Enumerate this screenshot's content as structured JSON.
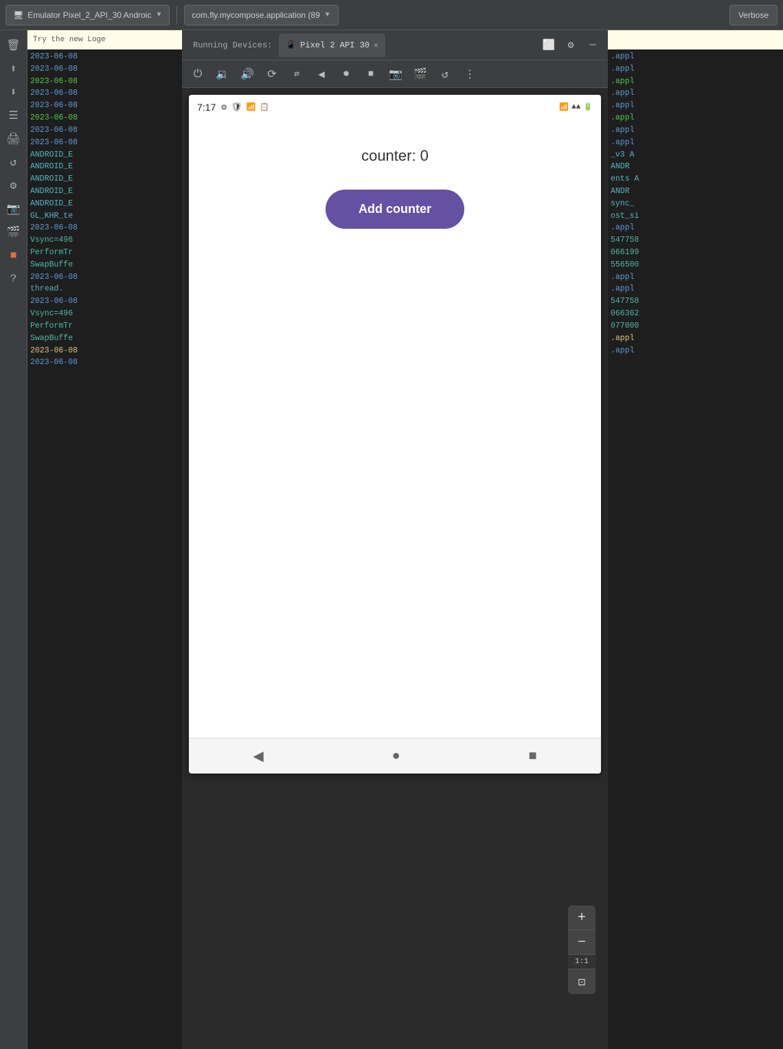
{
  "topbar": {
    "emulator_label": "Emulator Pixel_2_API_30 Androic",
    "app_id": "com.fly.mycompose.application (89",
    "verbose": "Verbose"
  },
  "running_devices": {
    "label": "Running Devices:",
    "tab_name": "Pixel 2 API 30"
  },
  "phone": {
    "time": "7:17",
    "counter_text": "counter: 0",
    "add_button_label": "Add counter"
  },
  "left_log": {
    "try_bar": "Try the new Loge",
    "lines": [
      {
        "text": "2023-06-08",
        "color": "blue"
      },
      {
        "text": "2023-06-08",
        "color": "blue"
      },
      {
        "text": "2023-06-08",
        "color": "green"
      },
      {
        "text": "2023-06-08",
        "color": "blue"
      },
      {
        "text": "2023-06-08",
        "color": "blue"
      },
      {
        "text": "2023-06-08",
        "color": "green"
      },
      {
        "text": "2023-06-08",
        "color": "blue"
      },
      {
        "text": "2023-06-08",
        "color": "blue"
      },
      {
        "text": "ANDROID_E",
        "color": "cyan"
      },
      {
        "text": "ANDROID_E",
        "color": "cyan"
      },
      {
        "text": "ANDROID_E",
        "color": "cyan"
      },
      {
        "text": "ANDROID_E",
        "color": "cyan"
      },
      {
        "text": "ANDROID_E",
        "color": "cyan"
      },
      {
        "text": "GL_KHR_te",
        "color": "cyan"
      },
      {
        "text": "2023-06-08",
        "color": "blue"
      },
      {
        "text": "Vsync=496",
        "color": "teal"
      },
      {
        "text": "PerformTr",
        "color": "teal"
      },
      {
        "text": "SwapBuffe",
        "color": "teal"
      },
      {
        "text": "2023-06-08",
        "color": "blue"
      },
      {
        "text": "thread.",
        "color": "teal"
      },
      {
        "text": "2023-06-08",
        "color": "blue"
      },
      {
        "text": "Vsync=496",
        "color": "teal"
      },
      {
        "text": "PerformTr",
        "color": "teal"
      },
      {
        "text": "SwapBuffe",
        "color": "teal"
      },
      {
        "text": "2023-06-08",
        "color": "yellow"
      },
      {
        "text": "2023-06-08",
        "color": "blue"
      }
    ]
  },
  "right_log": {
    "try_bar": "",
    "lines": [
      {
        "text": ".appl",
        "color": "blue"
      },
      {
        "text": ".appl",
        "color": "blue"
      },
      {
        "text": ".appl",
        "color": "green"
      },
      {
        "text": ".appl",
        "color": "blue"
      },
      {
        "text": ".appl",
        "color": "blue"
      },
      {
        "text": ".appl",
        "color": "green"
      },
      {
        "text": ".appl",
        "color": "blue"
      },
      {
        "text": ".appl",
        "color": "blue"
      },
      {
        "text": "_v3 A",
        "color": "cyan"
      },
      {
        "text": "ANDR",
        "color": "cyan"
      },
      {
        "text": "ents A",
        "color": "cyan"
      },
      {
        "text": "ANDR",
        "color": "cyan"
      },
      {
        "text": "sync_",
        "color": "cyan"
      },
      {
        "text": "ost_si",
        "color": "cyan"
      },
      {
        "text": ".appl",
        "color": "blue"
      },
      {
        "text": "547758",
        "color": "teal"
      },
      {
        "text": "066199",
        "color": "teal"
      },
      {
        "text": "556500",
        "color": "teal"
      },
      {
        "text": ".appl",
        "color": "blue"
      },
      {
        "text": "",
        "color": "white"
      },
      {
        "text": ".appl",
        "color": "blue"
      },
      {
        "text": "547758",
        "color": "teal"
      },
      {
        "text": "066362",
        "color": "teal"
      },
      {
        "text": "077000",
        "color": "teal"
      },
      {
        "text": ".appl",
        "color": "yellow"
      },
      {
        "text": ".appl",
        "color": "blue"
      }
    ]
  },
  "icons": {
    "trash": "🗑",
    "push": "⬆",
    "pull": "⬇",
    "list": "☰",
    "print": "🖨",
    "refresh": "↺",
    "settings": "⚙",
    "camera": "📷",
    "video": "🎬",
    "question": "?",
    "power": "⏻",
    "volume_down": "🔉",
    "volume_up": "🔊",
    "rotate": "⟳",
    "back_btn": "⏴",
    "home_btn": "⏺",
    "recent_btn": "⏹",
    "window": "⬜",
    "gear": "⚙",
    "minus_window": "—",
    "zoom_plus": "+",
    "zoom_minus": "−",
    "zoom_fit": "1:1",
    "zoom_frame": "⊡",
    "more_vert": "⋮"
  }
}
